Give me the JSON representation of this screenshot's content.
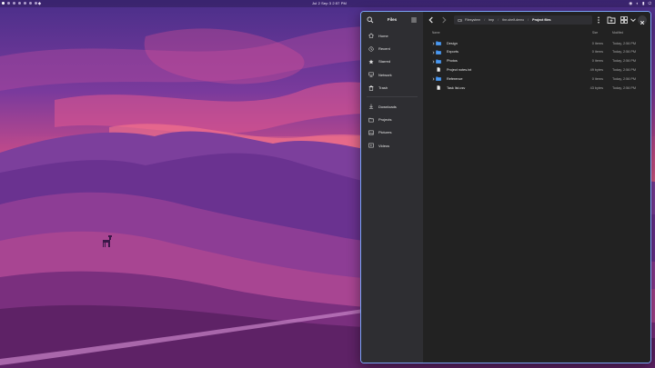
{
  "topbar": {
    "clock": "Jul 2 Sep 3 2:57 PM",
    "workspace_dots": 8,
    "tray_icons": [
      "network-icon",
      "volume-icon",
      "battery-icon",
      "power-icon"
    ]
  },
  "window": {
    "sidebar": {
      "title": "Files",
      "places": [
        {
          "label": "Home",
          "icon": "home-icon"
        },
        {
          "label": "Recent",
          "icon": "clock-icon"
        },
        {
          "label": "Starred",
          "icon": "star-icon"
        },
        {
          "label": "Network",
          "icon": "network-icon"
        },
        {
          "label": "Trash",
          "icon": "trash-icon"
        }
      ],
      "bookmarks": [
        {
          "label": "Downloads",
          "icon": "download-icon"
        },
        {
          "label": "Projects",
          "icon": "folder-icon"
        },
        {
          "label": "Pictures",
          "icon": "picture-icon"
        },
        {
          "label": "Videos",
          "icon": "video-icon"
        }
      ]
    },
    "breadcrumb": [
      "Filesystem",
      "tmp",
      "the-shelf-demo",
      "Project files"
    ],
    "columns": {
      "name": "Name",
      "size": "Size",
      "modified": "Modified"
    },
    "files": [
      {
        "name": "Design",
        "type": "folder",
        "size": "0 items",
        "modified": "Today, 2:56 PM"
      },
      {
        "name": "Exports",
        "type": "folder",
        "size": "0 items",
        "modified": "Today, 2:56 PM"
      },
      {
        "name": "Photos",
        "type": "folder",
        "size": "0 items",
        "modified": "Today, 2:56 PM"
      },
      {
        "name": "Project notes.txt",
        "type": "file",
        "size": "49 bytes",
        "modified": "Today, 2:56 PM"
      },
      {
        "name": "Reference",
        "type": "folder",
        "size": "0 items",
        "modified": "Today, 2:56 PM"
      },
      {
        "name": "Task list.csv",
        "type": "file",
        "size": "43 bytes",
        "modified": "Today, 2:56 PM"
      }
    ],
    "colors": {
      "accent": "#7aa3f5",
      "folder": "#3d8ae8",
      "sidebar_bg": "#2e2e32",
      "content_bg": "#222222"
    }
  }
}
